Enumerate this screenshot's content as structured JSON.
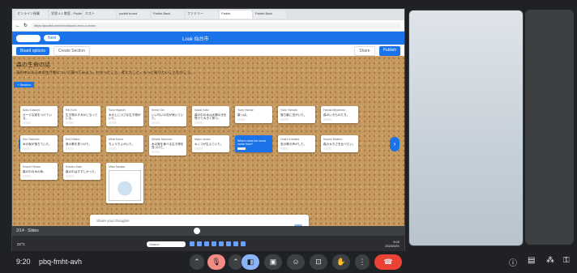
{
  "browser": {
    "tabs": [
      "オンライン授業",
      "学習 4-1 教室 - Padlet",
      "ホスト",
      "padlet board",
      "Padlet Back",
      "ファミリー",
      "Padlet",
      "Padlet Back"
    ],
    "address": "https://padlet.com/xxxx/board-xxxx-x-xxxxx"
  },
  "app": {
    "mode": "Next",
    "title": "Look 仙台市"
  },
  "toolbar": {
    "left": [
      "Board options",
      "Create Section"
    ],
    "right": [
      "Share",
      "Publish"
    ]
  },
  "board": {
    "heading": "森の生命の話",
    "subheading": "森の中にある木の生き物について調べてみよう。わかったこと、考えたこと、もっと知りたいことをかこう。",
    "section": "+ Section"
  },
  "cards": [
    {
      "name": "Aoko Kakumi",
      "text": "ガークな実をつけている。"
    },
    {
      "name": "Rin Kohi",
      "text": "生き物のすみかになっている。"
    },
    {
      "name": "Sora Higashi",
      "text": "木の上に小さな生き物がいた。"
    },
    {
      "name": "Kenta Sei",
      "text": "いい匂いの花が咲いていた。"
    },
    {
      "name": "Naoki Kato",
      "text": "森の中の木は太陽の光を受けて大きく育つ。"
    },
    {
      "name": "Yumi Hamai",
      "text": "葉っぱ。"
    },
    {
      "name": "Yuko Yamato",
      "text": "落ち葉に虫がいた。"
    },
    {
      "name": "Haruki Miyamoto",
      "text": "森のいきものたち。"
    },
    {
      "name": "Ken Saimoto",
      "text": "木の実が落ちていた。"
    },
    {
      "name": "Emi Kitano",
      "text": "鳥の巣を見つけた。"
    },
    {
      "name": "Mirai Kawa",
      "text": "ちょうちょがいた。"
    },
    {
      "name": "Minato Sakuma",
      "text": "木の実を食べる生き物を見つけた。"
    },
    {
      "name": "Mayu Jones",
      "text": "キノコが生えていた。"
    },
    {
      "name": "",
      "text": "Where does the wood come from?"
    },
    {
      "name": "Hoshi Kobashi",
      "text": "虫の鳴き声がした。"
    },
    {
      "name": "Kazuki Makino",
      "text": "森の大きさを比べたい。"
    },
    {
      "name": "Kozue Hirano",
      "text": "森の中の木の命。"
    },
    {
      "name": "Koharu Kato",
      "text": "森の中はすずしかった。"
    },
    {
      "name": "Mika Tanaka",
      "text": ""
    }
  ],
  "composer": {
    "placeholder": "Share your thoughts"
  },
  "boardbar": {
    "left": "2/14 · Slides",
    "right": ""
  },
  "taskbar": {
    "search": "Search",
    "time": "9:20",
    "date": "2024/5/21",
    "weather": "22°C"
  },
  "meet": {
    "time": "9:20",
    "code": "pbq-fmht-avh"
  }
}
